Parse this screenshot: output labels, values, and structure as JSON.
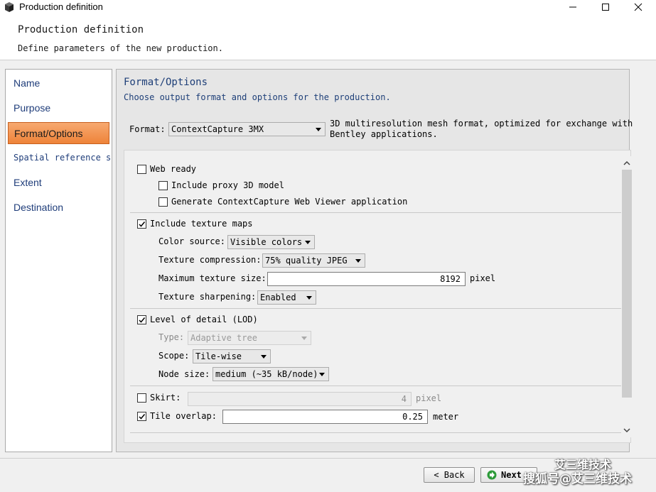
{
  "window": {
    "title": "Production definition"
  },
  "header": {
    "title": "Production definition",
    "subtitle": "Define parameters of the new production."
  },
  "sidebar": {
    "items": [
      {
        "label": "Name",
        "active": false
      },
      {
        "label": "Purpose",
        "active": false
      },
      {
        "label": "Format/Options",
        "active": true
      },
      {
        "label": "Spatial reference s",
        "active": false
      },
      {
        "label": "Extent",
        "active": false
      },
      {
        "label": "Destination",
        "active": false
      }
    ]
  },
  "section": {
    "title": "Format/Options",
    "subtitle": "Choose output format and options for the production."
  },
  "format": {
    "label": "Format:",
    "value": "ContextCapture 3MX",
    "description_line1": "3D multiresolution mesh format, optimized for exchange with",
    "description_line2": "Bentley applications."
  },
  "web_ready": {
    "label": "Web ready",
    "checked": false,
    "proxy_label": "Include proxy 3D model",
    "proxy_checked": false,
    "viewer_label": "Generate ContextCapture Web Viewer application",
    "viewer_checked": false
  },
  "texture": {
    "label": "Include texture maps",
    "checked": true,
    "color_source_label": "Color source:",
    "color_source_value": "Visible colors",
    "compression_label": "Texture compression:",
    "compression_value": "75% quality JPEG",
    "max_size_label": "Maximum texture size:",
    "max_size_value": "8192",
    "max_size_unit": "pixel",
    "sharpening_label": "Texture sharpening:",
    "sharpening_value": "Enabled"
  },
  "lod": {
    "label": "Level of detail (LOD)",
    "checked": true,
    "type_label": "Type:",
    "type_value": "Adaptive tree",
    "scope_label": "Scope:",
    "scope_value": "Tile-wise",
    "node_size_label": "Node size:",
    "node_size_value": "medium (~35 kB/node)"
  },
  "skirt": {
    "label": "Skirt:",
    "checked": false,
    "value": "4",
    "unit": "pixel"
  },
  "tile_overlap": {
    "label": "Tile overlap:",
    "checked": true,
    "value": "0.25",
    "unit": "meter"
  },
  "footer": {
    "back_label": "< Back",
    "next_label": "Next",
    "watermark_top": "艾三维技术",
    "watermark": "搜狐号@艾三维技术"
  },
  "colors": {
    "accent_orange": "#ee8339",
    "heading_blue": "#1e3f78",
    "nav_blue": "#1f3d7a"
  },
  "icons": {
    "app": "3d-cube-icon",
    "minimize": "minimize-icon",
    "maximize": "maximize-icon",
    "close": "close-icon",
    "next": "green-arrow-icon",
    "scroll_up": "chevron-up-icon",
    "scroll_down": "chevron-down-icon"
  }
}
